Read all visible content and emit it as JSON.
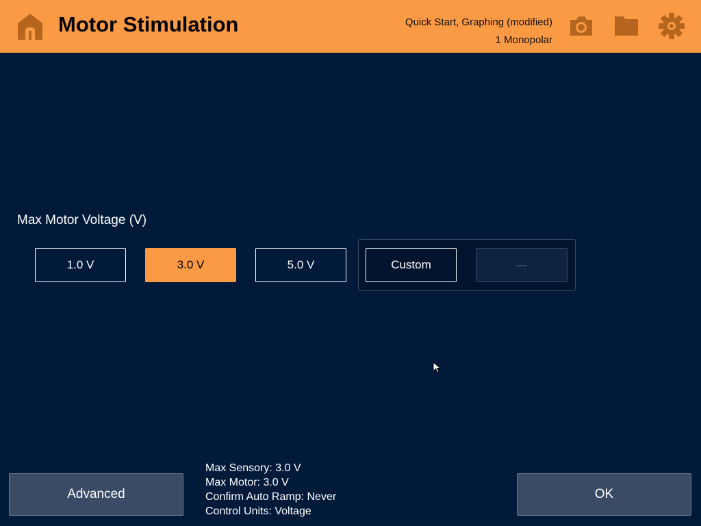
{
  "header": {
    "title": "Motor Stimulation",
    "preset_line1": "Quick Start, Graphing (modified)",
    "preset_line2": "1 Monopolar",
    "icons": [
      "home-icon",
      "camera-icon",
      "folder-icon",
      "gear-icon"
    ],
    "background_color": "#fb9a45",
    "icon_color": "#b5651d"
  },
  "voltage": {
    "label": "Max Motor Voltage (V)",
    "options": [
      "1.0 V",
      "3.0 V",
      "5.0 V"
    ],
    "selected": "3.0 V",
    "custom_label": "Custom",
    "custom_value": "---"
  },
  "summary": {
    "max_sensory": "Max Sensory: 3.0 V",
    "max_motor": "Max Motor: 3.0 V",
    "confirm_auto_ramp": "Confirm Auto Ramp: Never",
    "control_units": "Control Units: Voltage"
  },
  "footer": {
    "advanced_label": "Advanced",
    "ok_label": "OK"
  },
  "colors": {
    "background": "#011a3a",
    "accent": "#fb9a45",
    "button_bg": "#3a4b66"
  }
}
